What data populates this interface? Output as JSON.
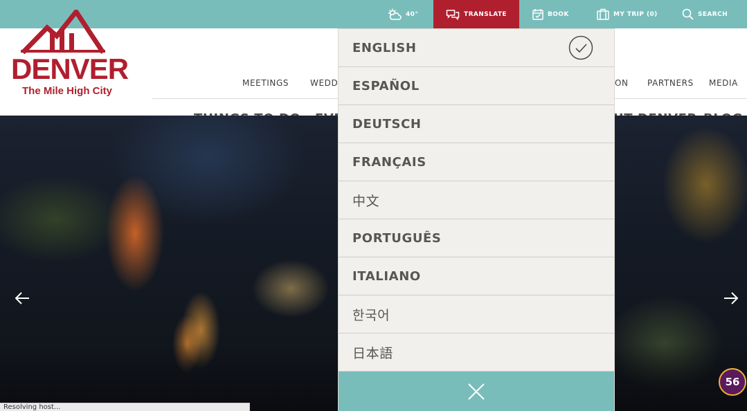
{
  "topbar": {
    "weather": {
      "temp": "40°",
      "icon": "partly-cloudy-icon"
    },
    "translate": {
      "label": "TRANSLATE",
      "icon": "speech-bubbles-icon"
    },
    "book": {
      "label": "BOOK",
      "icon": "calendar-check-icon"
    },
    "mytrip": {
      "label": "MY TRIP (0)",
      "icon": "suitcase-icon"
    },
    "search": {
      "label": "SEARCH",
      "icon": "search-icon"
    }
  },
  "logo": {
    "word": "DENVER",
    "tagline": "The Mile High City"
  },
  "subnav": [
    {
      "label": "MEETINGS"
    },
    {
      "label": "WEDD"
    },
    {
      "label": "ON"
    },
    {
      "label": "PARTNERS"
    },
    {
      "label": "MEDIA"
    }
  ],
  "mainnav": [
    {
      "label": "THINGS TO DO"
    },
    {
      "label": "EVE"
    },
    {
      "label": "UT DENVER"
    },
    {
      "label": "BLOG"
    }
  ],
  "languages": [
    {
      "label": "ENGLISH",
      "selected": true
    },
    {
      "label": "ESPAÑOL"
    },
    {
      "label": "DEUTSCH"
    },
    {
      "label": "FRANÇAIS"
    },
    {
      "label": "中文"
    },
    {
      "label": "PORTUGUÊS"
    },
    {
      "label": "ITALIANO"
    },
    {
      "label": "한국어"
    },
    {
      "label": "日本語"
    }
  ],
  "badge": {
    "count": "56"
  },
  "status": {
    "text": "Resolving host..."
  },
  "colors": {
    "teal": "#79bdbb",
    "brand_red": "#b01f2e",
    "dropdown_bg": "#f1f0ec",
    "badge": "#5a1a5c"
  }
}
